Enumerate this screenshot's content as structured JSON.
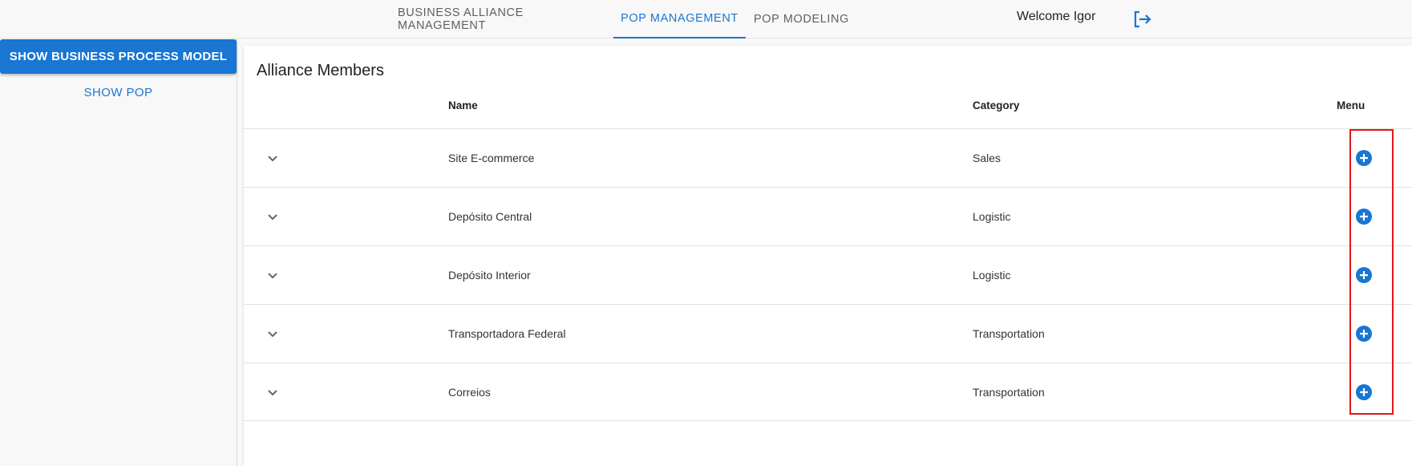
{
  "nav": {
    "tabs": [
      {
        "label": "BUSINESS ALLIANCE MANAGEMENT"
      },
      {
        "label": "POP MANAGEMENT"
      },
      {
        "label": "POP MODELING"
      }
    ],
    "welcome": "Welcome Igor"
  },
  "sidebar": {
    "primary_button": "SHOW BUSINESS PROCESS MODEL",
    "secondary_button": "SHOW POP"
  },
  "main": {
    "title": "Alliance Members",
    "columns": {
      "name": "Name",
      "category": "Category",
      "menu": "Menu"
    },
    "rows": [
      {
        "name": "Site E-commerce",
        "category": "Sales"
      },
      {
        "name": "Depósito Central",
        "category": "Logistic"
      },
      {
        "name": "Depósito Interior",
        "category": "Logistic"
      },
      {
        "name": "Transportadora Federal",
        "category": "Transportation"
      },
      {
        "name": "Correios",
        "category": "Transportation"
      }
    ]
  },
  "colors": {
    "accent": "#1976d2",
    "highlight": "#e01818"
  },
  "icons": {
    "logout": "logout-icon",
    "expand": "chevron-down-icon",
    "add": "plus-circle-icon"
  }
}
